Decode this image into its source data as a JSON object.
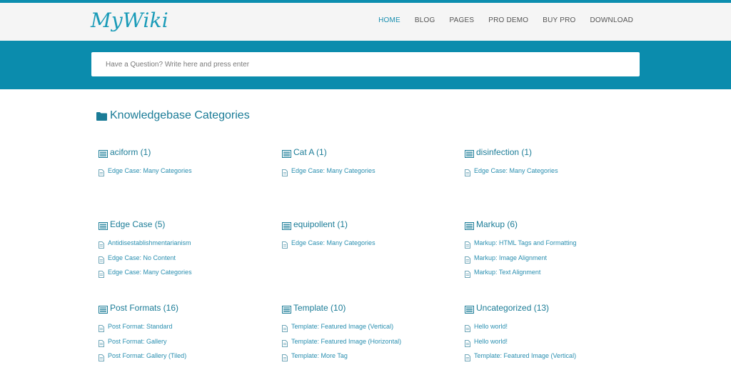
{
  "site": {
    "logo": "MyWiki",
    "accent": "#0b8cad"
  },
  "nav": [
    {
      "label": "HOME",
      "active": true
    },
    {
      "label": "BLOG"
    },
    {
      "label": "PAGES"
    },
    {
      "label": "PRO DEMO"
    },
    {
      "label": "BUY PRO"
    },
    {
      "label": "DOWNLOAD"
    }
  ],
  "search": {
    "placeholder": "Have a Question? Write here and press enter"
  },
  "section": {
    "title": "Knowledgebase Categories",
    "icon": "folder-icon"
  },
  "categories": [
    {
      "title": "aciform (1)",
      "links": [
        "Edge Case: Many Categories"
      ]
    },
    {
      "title": "Cat A (1)",
      "links": [
        "Edge Case: Many Categories"
      ]
    },
    {
      "title": "disinfection (1)",
      "links": [
        "Edge Case: Many Categories"
      ]
    },
    {
      "title": "Edge Case (5)",
      "links": [
        "Antidisestablishmentarianism",
        "Edge Case: No Content",
        "Edge Case: Many Categories"
      ]
    },
    {
      "title": "equipollent (1)",
      "links": [
        "Edge Case: Many Categories"
      ]
    },
    {
      "title": "Markup (6)",
      "links": [
        "Markup: HTML Tags and Formatting",
        "Markup: Image Alignment",
        "Markup: Text Alignment"
      ]
    },
    {
      "title": "Post Formats (16)",
      "links": [
        "Post Format: Standard",
        "Post Format: Gallery",
        "Post Format: Gallery (Tiled)"
      ]
    },
    {
      "title": "Template (10)",
      "links": [
        "Template: Featured Image (Vertical)",
        "Template: Featured Image (Horizontal)",
        "Template: More Tag"
      ]
    },
    {
      "title": "Uncategorized (13)",
      "links": [
        "Hello world!",
        "Hello world!",
        "Template: Featured Image (Vertical)"
      ]
    }
  ]
}
